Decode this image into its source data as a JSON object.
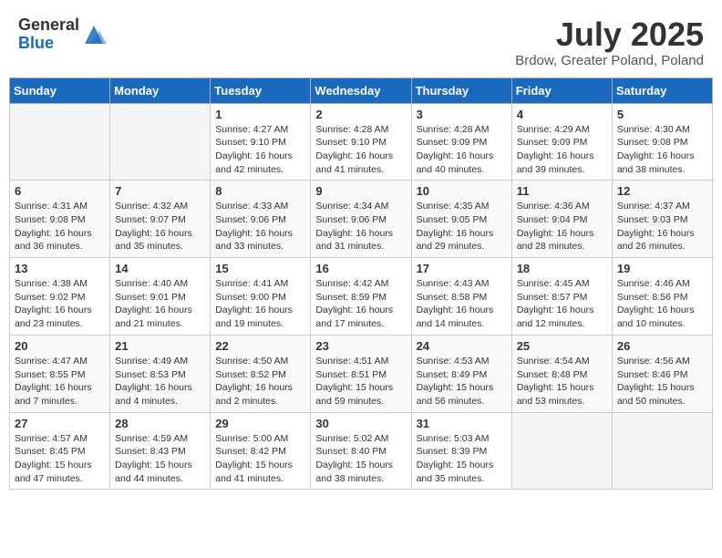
{
  "logo": {
    "general": "General",
    "blue": "Blue"
  },
  "title": {
    "month_year": "July 2025",
    "location": "Brdow, Greater Poland, Poland"
  },
  "days_of_week": [
    "Sunday",
    "Monday",
    "Tuesday",
    "Wednesday",
    "Thursday",
    "Friday",
    "Saturday"
  ],
  "weeks": [
    [
      {
        "day": "",
        "info": ""
      },
      {
        "day": "",
        "info": ""
      },
      {
        "day": "1",
        "info": "Sunrise: 4:27 AM\nSunset: 9:10 PM\nDaylight: 16 hours and 42 minutes."
      },
      {
        "day": "2",
        "info": "Sunrise: 4:28 AM\nSunset: 9:10 PM\nDaylight: 16 hours and 41 minutes."
      },
      {
        "day": "3",
        "info": "Sunrise: 4:28 AM\nSunset: 9:09 PM\nDaylight: 16 hours and 40 minutes."
      },
      {
        "day": "4",
        "info": "Sunrise: 4:29 AM\nSunset: 9:09 PM\nDaylight: 16 hours and 39 minutes."
      },
      {
        "day": "5",
        "info": "Sunrise: 4:30 AM\nSunset: 9:08 PM\nDaylight: 16 hours and 38 minutes."
      }
    ],
    [
      {
        "day": "6",
        "info": "Sunrise: 4:31 AM\nSunset: 9:08 PM\nDaylight: 16 hours and 36 minutes."
      },
      {
        "day": "7",
        "info": "Sunrise: 4:32 AM\nSunset: 9:07 PM\nDaylight: 16 hours and 35 minutes."
      },
      {
        "day": "8",
        "info": "Sunrise: 4:33 AM\nSunset: 9:06 PM\nDaylight: 16 hours and 33 minutes."
      },
      {
        "day": "9",
        "info": "Sunrise: 4:34 AM\nSunset: 9:06 PM\nDaylight: 16 hours and 31 minutes."
      },
      {
        "day": "10",
        "info": "Sunrise: 4:35 AM\nSunset: 9:05 PM\nDaylight: 16 hours and 29 minutes."
      },
      {
        "day": "11",
        "info": "Sunrise: 4:36 AM\nSunset: 9:04 PM\nDaylight: 16 hours and 28 minutes."
      },
      {
        "day": "12",
        "info": "Sunrise: 4:37 AM\nSunset: 9:03 PM\nDaylight: 16 hours and 26 minutes."
      }
    ],
    [
      {
        "day": "13",
        "info": "Sunrise: 4:38 AM\nSunset: 9:02 PM\nDaylight: 16 hours and 23 minutes."
      },
      {
        "day": "14",
        "info": "Sunrise: 4:40 AM\nSunset: 9:01 PM\nDaylight: 16 hours and 21 minutes."
      },
      {
        "day": "15",
        "info": "Sunrise: 4:41 AM\nSunset: 9:00 PM\nDaylight: 16 hours and 19 minutes."
      },
      {
        "day": "16",
        "info": "Sunrise: 4:42 AM\nSunset: 8:59 PM\nDaylight: 16 hours and 17 minutes."
      },
      {
        "day": "17",
        "info": "Sunrise: 4:43 AM\nSunset: 8:58 PM\nDaylight: 16 hours and 14 minutes."
      },
      {
        "day": "18",
        "info": "Sunrise: 4:45 AM\nSunset: 8:57 PM\nDaylight: 16 hours and 12 minutes."
      },
      {
        "day": "19",
        "info": "Sunrise: 4:46 AM\nSunset: 8:56 PM\nDaylight: 16 hours and 10 minutes."
      }
    ],
    [
      {
        "day": "20",
        "info": "Sunrise: 4:47 AM\nSunset: 8:55 PM\nDaylight: 16 hours and 7 minutes."
      },
      {
        "day": "21",
        "info": "Sunrise: 4:49 AM\nSunset: 8:53 PM\nDaylight: 16 hours and 4 minutes."
      },
      {
        "day": "22",
        "info": "Sunrise: 4:50 AM\nSunset: 8:52 PM\nDaylight: 16 hours and 2 minutes."
      },
      {
        "day": "23",
        "info": "Sunrise: 4:51 AM\nSunset: 8:51 PM\nDaylight: 15 hours and 59 minutes."
      },
      {
        "day": "24",
        "info": "Sunrise: 4:53 AM\nSunset: 8:49 PM\nDaylight: 15 hours and 56 minutes."
      },
      {
        "day": "25",
        "info": "Sunrise: 4:54 AM\nSunset: 8:48 PM\nDaylight: 15 hours and 53 minutes."
      },
      {
        "day": "26",
        "info": "Sunrise: 4:56 AM\nSunset: 8:46 PM\nDaylight: 15 hours and 50 minutes."
      }
    ],
    [
      {
        "day": "27",
        "info": "Sunrise: 4:57 AM\nSunset: 8:45 PM\nDaylight: 15 hours and 47 minutes."
      },
      {
        "day": "28",
        "info": "Sunrise: 4:59 AM\nSunset: 8:43 PM\nDaylight: 15 hours and 44 minutes."
      },
      {
        "day": "29",
        "info": "Sunrise: 5:00 AM\nSunset: 8:42 PM\nDaylight: 15 hours and 41 minutes."
      },
      {
        "day": "30",
        "info": "Sunrise: 5:02 AM\nSunset: 8:40 PM\nDaylight: 15 hours and 38 minutes."
      },
      {
        "day": "31",
        "info": "Sunrise: 5:03 AM\nSunset: 8:39 PM\nDaylight: 15 hours and 35 minutes."
      },
      {
        "day": "",
        "info": ""
      },
      {
        "day": "",
        "info": ""
      }
    ]
  ]
}
